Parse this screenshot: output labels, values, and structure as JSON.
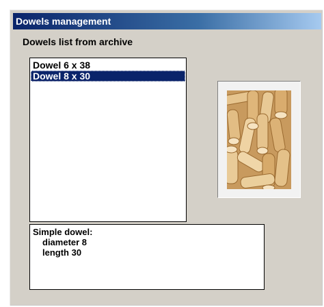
{
  "window": {
    "title": "Dowels management"
  },
  "dowels_group": {
    "label": "Dowels list from archive"
  },
  "dowels_list": {
    "items": [
      "Dowel 6 x 38",
      "Dowel 8 x 30"
    ],
    "selected_index": 1
  },
  "description": {
    "heading": "Simple dowel:",
    "line1": "diameter 8",
    "line2": "length 30"
  },
  "preview": {
    "icon": "wooden-dowels-photo"
  },
  "colors": {
    "selection": "#0a246a",
    "window_bg": "#d4d0c8",
    "title_bar": "#0a246a"
  }
}
